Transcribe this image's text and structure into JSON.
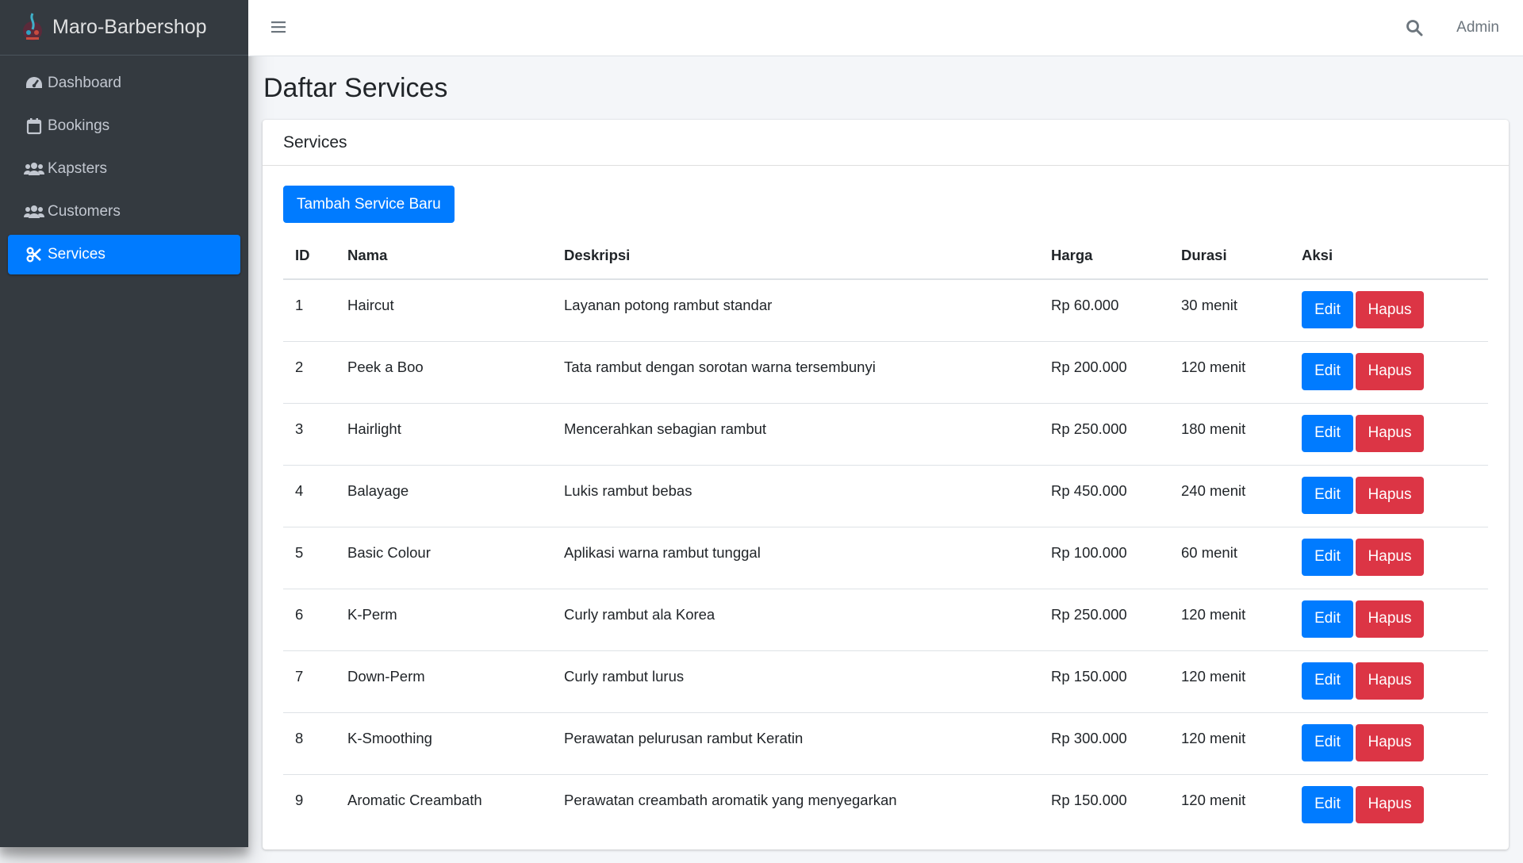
{
  "app": {
    "brand_main": "Maro",
    "brand_rest": "-Barbershop"
  },
  "sidebar": {
    "items": [
      {
        "label": "Dashboard",
        "icon": "tachometer-icon"
      },
      {
        "label": "Bookings",
        "icon": "calendar-icon"
      },
      {
        "label": "Kapsters",
        "icon": "users-icon"
      },
      {
        "label": "Customers",
        "icon": "users-icon"
      },
      {
        "label": "Services",
        "icon": "scissors-icon",
        "active": true
      }
    ]
  },
  "topbar": {
    "user": "Admin"
  },
  "page": {
    "title": "Daftar Services"
  },
  "card": {
    "header": "Services",
    "add_button": "Tambah Service Baru",
    "columns": [
      "ID",
      "Nama",
      "Deskripsi",
      "Harga",
      "Durasi",
      "Aksi"
    ],
    "rows": [
      {
        "id": "1",
        "nama": "Haircut",
        "deskripsi": "Layanan potong rambut standar",
        "harga": "Rp 60.000",
        "durasi": "30 menit"
      },
      {
        "id": "2",
        "nama": "Peek a Boo",
        "deskripsi": "Tata rambut dengan sorotan warna tersembunyi",
        "harga": "Rp 200.000",
        "durasi": "120 menit"
      },
      {
        "id": "3",
        "nama": "Hairlight",
        "deskripsi": "Mencerahkan sebagian rambut",
        "harga": "Rp 250.000",
        "durasi": "180 menit"
      },
      {
        "id": "4",
        "nama": "Balayage",
        "deskripsi": "Lukis rambut bebas",
        "harga": "Rp 450.000",
        "durasi": "240 menit"
      },
      {
        "id": "5",
        "nama": "Basic Colour",
        "deskripsi": "Aplikasi warna rambut tunggal",
        "harga": "Rp 100.000",
        "durasi": "60 menit"
      },
      {
        "id": "6",
        "nama": "K-Perm",
        "deskripsi": "Curly rambut ala Korea",
        "harga": "Rp 250.000",
        "durasi": "120 menit"
      },
      {
        "id": "7",
        "nama": "Down-Perm",
        "deskripsi": "Curly rambut lurus",
        "harga": "Rp 150.000",
        "durasi": "120 menit"
      },
      {
        "id": "8",
        "nama": "K-Smoothing",
        "deskripsi": "Perawatan pelurusan rambut Keratin",
        "harga": "Rp 300.000",
        "durasi": "120 menit"
      },
      {
        "id": "9",
        "nama": "Aromatic Creambath",
        "deskripsi": "Perawatan creambath aromatik yang menyegarkan",
        "harga": "Rp 150.000",
        "durasi": "120 menit"
      }
    ],
    "edit_label": "Edit",
    "delete_label": "Hapus"
  },
  "colors": {
    "primary": "#007bff",
    "danger": "#dc3545",
    "sidebar": "#343a40"
  }
}
